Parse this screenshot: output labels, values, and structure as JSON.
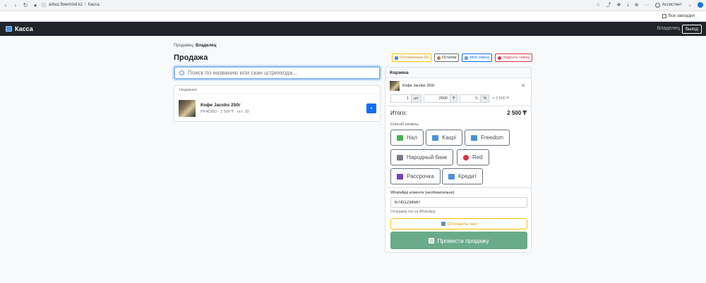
{
  "browser": {
    "url_host": "arbuz.flowmind.kz",
    "url_sep": "/",
    "url_page": "Касса",
    "assistant_label": "Ассистент",
    "bookmarks_label": "Все закладки"
  },
  "navbar": {
    "brand": "Касса",
    "user": "Владелец",
    "logout": "Выход"
  },
  "seller": {
    "label": "Продавец:",
    "name": "Владелец"
  },
  "page": {
    "title": "Продажа"
  },
  "actions": {
    "deferred": "Отложенные (0)",
    "stock": "Остатки",
    "my_shift": "Моя смена",
    "close_shift": "Закрыть смену"
  },
  "search": {
    "placeholder": "Поиск по названию или скан штрихкода..."
  },
  "recent": {
    "title": "Недавние",
    "items": [
      {
        "name": "Кофе Jacobs 250г",
        "meta": "PF4626D · 2 500 ₸ · ост. 20",
        "add_label": "+"
      }
    ]
  },
  "cart": {
    "title": "Корзина",
    "items": [
      {
        "name": "Кофе Jacobs 250г",
        "qty": "1",
        "qty_unit": "шт",
        "price": "2500",
        "price_unit": "₸",
        "discount": "",
        "discount_placeholder": "%",
        "discount_unit": "%",
        "line_total": "= 2 500 ₸",
        "remove": "✕"
      }
    ],
    "total_label": "Итого:",
    "total_value": "2 500 ₸",
    "payment_label": "Способ оплаты:",
    "payment_methods": [
      "Нал",
      "Kaspi",
      "Freedom",
      "Народный банк",
      "Red",
      "Рассрочка",
      "Кредит"
    ],
    "whatsapp_label": "WhatsApp клиента (необязательно)",
    "whatsapp_value": "87001234567",
    "whatsapp_hint": "Отправим чек на WhatsApp",
    "defer_label": "Отложить чек",
    "submit_label": "Провести продажу"
  },
  "colors": {
    "navbar_bg": "#212529",
    "primary": "#0d6efd",
    "success_muted": "#6aab8a",
    "warning": "#ffc107",
    "danger": "#dc3545"
  }
}
